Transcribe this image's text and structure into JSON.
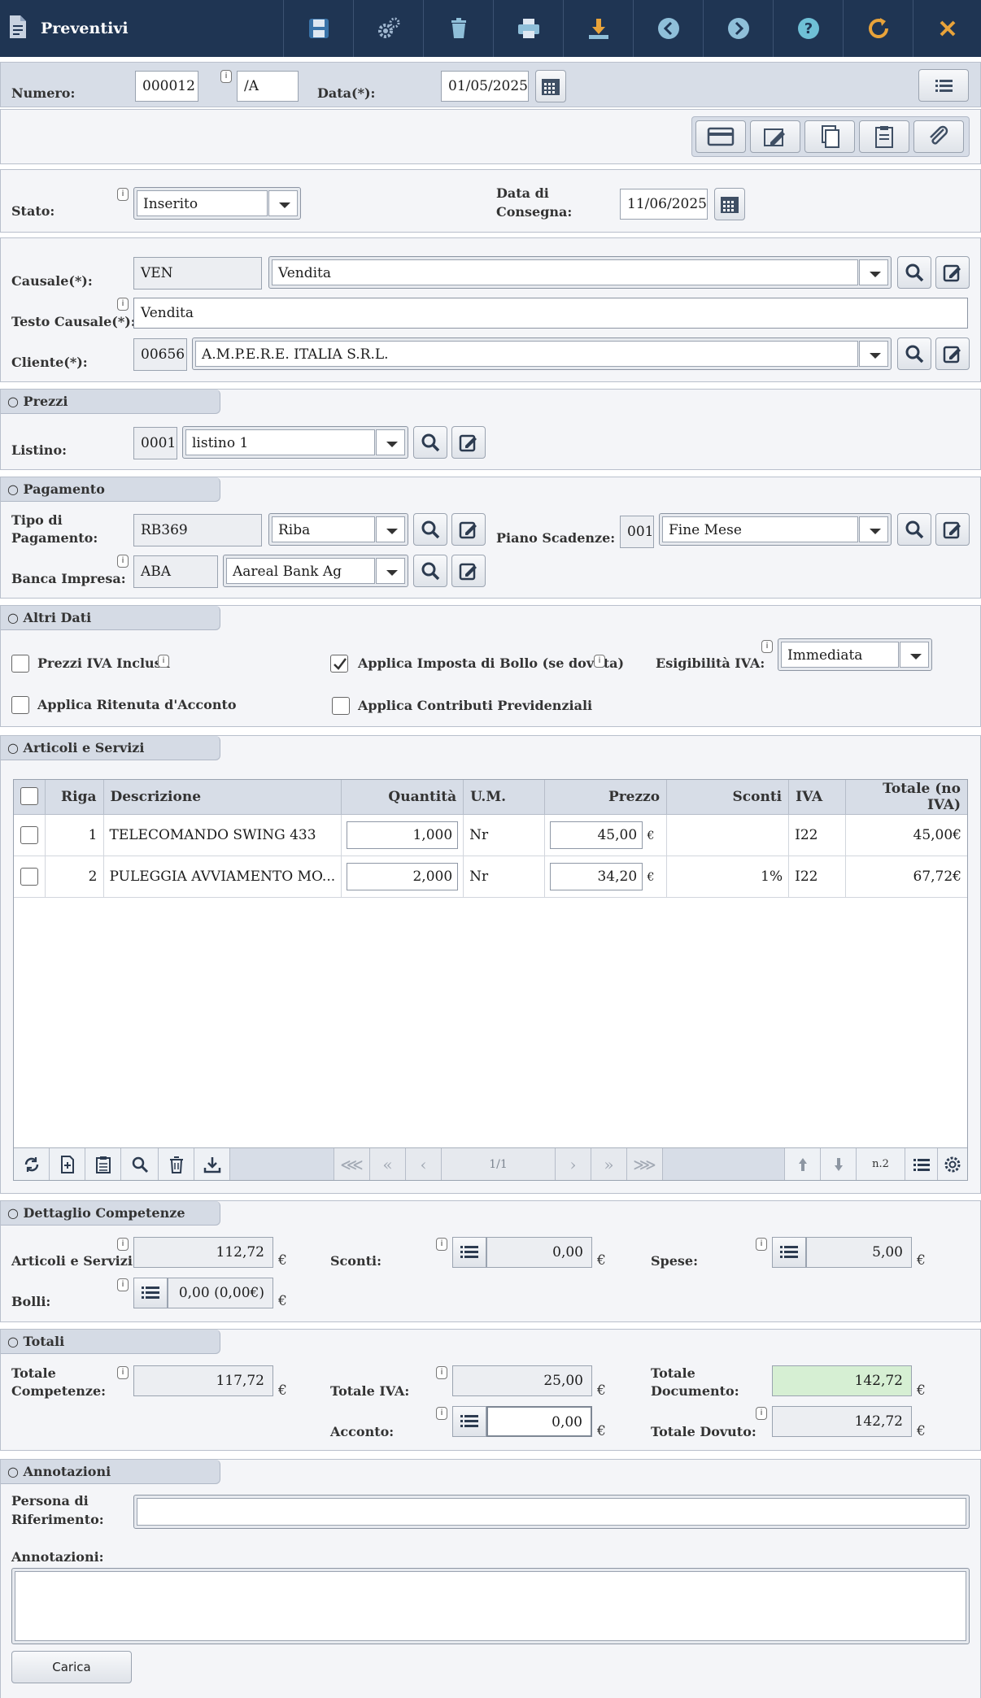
{
  "app": {
    "title": "Preventivi"
  },
  "colors": {
    "toolbar_bg": "#1f3553",
    "panel_bg": "#f4f5f8",
    "section_tab": "#d5dbe5",
    "highlight_total": "#d6efd3",
    "icon_accent": "#e8a33a",
    "icon_blue": "#3a73a8"
  },
  "toolbar": {
    "icons": [
      "save-icon",
      "settings-icon",
      "delete-icon",
      "print-icon",
      "download-icon",
      "prev-icon",
      "next-icon",
      "help-icon",
      "refresh-icon",
      "close-icon"
    ]
  },
  "header": {
    "numero_label": "Numero:",
    "numero": "000012",
    "serie": "/A",
    "data_label": "Data(*):",
    "data": "01/05/2025"
  },
  "stato": {
    "stato_label": "Stato:",
    "stato": "Inserito",
    "consegna_label_1": "Data di",
    "consegna_label_2": "Consegna:",
    "consegna": "11/06/2025"
  },
  "causale": {
    "causale_label": "Causale(*):",
    "causale_code": "VEN",
    "causale": "Vendita",
    "testo_label": "Testo Causale(*):",
    "testo": "Vendita",
    "cliente_label": "Cliente(*):",
    "cliente_code": "00656",
    "cliente": "A.M.P.E.R.E. ITALIA S.R.L."
  },
  "prezzi": {
    "title": "○ Prezzi",
    "listino_label": "Listino:",
    "listino_code": "0001",
    "listino": "listino 1"
  },
  "pagamento": {
    "title": "○ Pagamento",
    "tipo_label_1": "Tipo di",
    "tipo_label_2": "Pagamento:",
    "tipo_code": "RB369",
    "tipo": "Riba",
    "piano_label": "Piano Scadenze:",
    "piano_code": "001",
    "piano": "Fine Mese",
    "banca_label": "Banca Impresa:",
    "banca_code": "ABA",
    "banca": "Aareal Bank Ag"
  },
  "altri": {
    "title": "○ Altri Dati",
    "prezzi_iva": "Prezzi IVA Inclusa",
    "prezzi_iva_checked": false,
    "bollo": "Applica Imposta di Bollo (se dovuta)",
    "bollo_checked": true,
    "esig_label": "Esigibilità IVA:",
    "esig": "Immediata",
    "ritenuta": "Applica Ritenuta d'Acconto",
    "ritenuta_checked": false,
    "contributi": "Applica Contributi Previdenziali",
    "contributi_checked": false
  },
  "articoli": {
    "title": "○ Articoli e Servizi",
    "columns": [
      "Riga",
      "Descrizione",
      "Quantità",
      "U.M.",
      "Prezzo",
      "Sconti",
      "IVA",
      "Totale (no IVA)"
    ],
    "rows": [
      {
        "riga": "1",
        "descrizione": "TELECOMANDO SWING 433",
        "quantita": "1,000",
        "um": "Nr",
        "prezzo": "45,00",
        "valuta": "€",
        "sconti": "",
        "iva": "I22",
        "totale": "45,00€"
      },
      {
        "riga": "2",
        "descrizione": "PULEGGIA AVVIAMENTO MO...",
        "quantita": "2,000",
        "um": "Nr",
        "prezzo": "34,20",
        "valuta": "€",
        "sconti": "1%",
        "iva": "I22",
        "totale": "67,72€"
      }
    ],
    "pager": {
      "first": "«‹«",
      "prev_block": "«",
      "prev": "‹",
      "page": "1/1",
      "next": "›",
      "next_block": "»",
      "last": "»»",
      "count": "n.2"
    }
  },
  "competenze": {
    "title": "○ Dettaglio Competenze",
    "articoli_label": "Articoli e Servizi:",
    "articoli": "112,72",
    "sconti_label": "Sconti:",
    "sconti": "0,00",
    "spese_label": "Spese:",
    "spese": "5,00",
    "bolli_label": "Bolli:",
    "bolli": "0,00 (0,00€)",
    "currency": "€"
  },
  "totali": {
    "title": "○ Totali",
    "competenze_label_1": "Totale",
    "competenze_label_2": "Competenze:",
    "competenze": "117,72",
    "iva_label": "Totale IVA:",
    "iva": "25,00",
    "documento_label_1": "Totale",
    "documento_label_2": "Documento:",
    "documento": "142,72",
    "acconto_label": "Acconto:",
    "acconto": "0,00",
    "dovuto_label": "Totale Dovuto:",
    "dovuto": "142,72",
    "currency": "€"
  },
  "annotazioni": {
    "title": "○ Annotazioni",
    "persona_label_1": "Persona di",
    "persona_label_2": "Riferimento:",
    "persona": "",
    "annot_label": "Annotazioni:",
    "annot": "",
    "carica": "Carica"
  }
}
